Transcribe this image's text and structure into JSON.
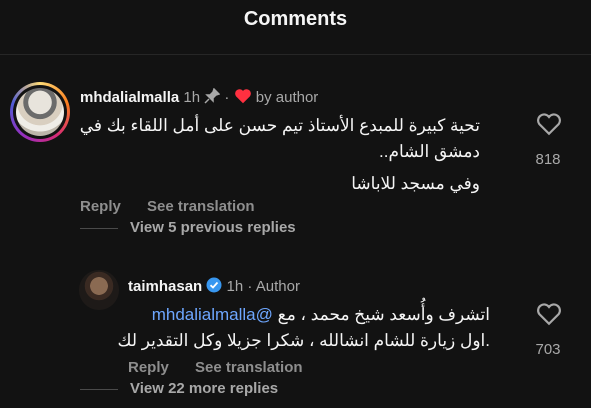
{
  "header": {
    "title": "Comments"
  },
  "comments": [
    {
      "username": "mhdalialmalla",
      "time": "1h",
      "separator": "·",
      "author_badge": "by author",
      "lines": [
        "تحية كبيرة للمبدع الأستاذ تيم حسن على أمل اللقاء بك في",
        "دمشق الشام..",
        "وفي مسجد للاباشا"
      ],
      "reply_label": "Reply",
      "translate_label": "See translation",
      "view_replies": "View 5 previous replies",
      "likes": "818"
    },
    {
      "username": "taimhasan",
      "time": "1h",
      "separator": "·",
      "author_label": "Author",
      "mention": "@mhdalialmalla",
      "line1_rest": "اتشرف وأُسعد شيخ محمد ، مع",
      "line2": ".اول زيارة للشام انشالله ، شكرا جزيلا وكل التقدير لك",
      "reply_label": "Reply",
      "translate_label": "See translation",
      "view_replies": "View 22 more replies",
      "likes": "703"
    }
  ],
  "colors": {
    "background": "#121212",
    "mention": "#6ea7ff",
    "heart_red": "#ff3040",
    "verified": "#3897f0"
  }
}
